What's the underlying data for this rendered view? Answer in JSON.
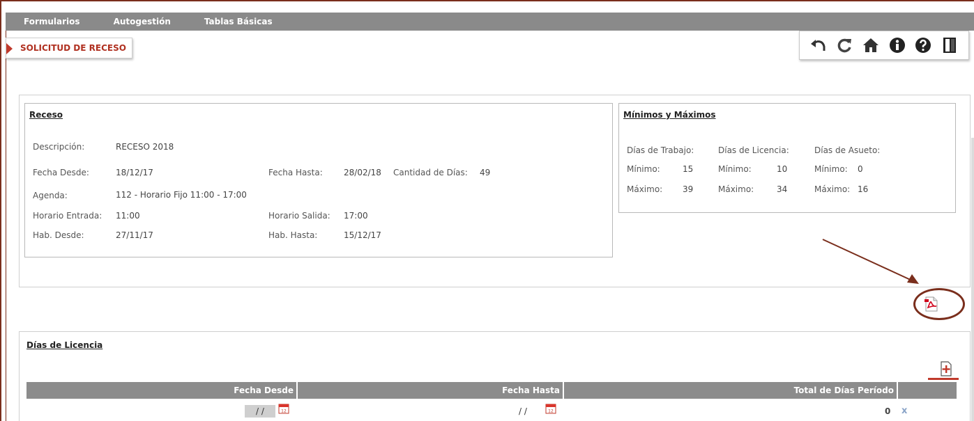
{
  "menu": [
    "Formularios",
    "Autogestión",
    "Tablas Básicas"
  ],
  "page_title": "SOLICITUD DE RECESO",
  "toolbar": [
    "back-icon",
    "refresh-icon",
    "home-icon",
    "info-icon",
    "help-icon",
    "exit-icon"
  ],
  "receso": {
    "title": "Receso",
    "descripcion_label": "Descripción:",
    "descripcion": "RECESO 2018",
    "fecha_desde_label": "Fecha Desde:",
    "fecha_desde": "18/12/17",
    "fecha_hasta_label": "Fecha Hasta:",
    "fecha_hasta": "28/02/18",
    "cantidad_label": "Cantidad de Días:",
    "cantidad": "49",
    "agenda_label": "Agenda:",
    "agenda": "112 - Horario Fijo 11:00 - 17:00",
    "horario_entrada_label": "Horario Entrada:",
    "horario_entrada": "11:00",
    "horario_salida_label": "Horario Salida:",
    "horario_salida": "17:00",
    "hab_desde_label": "Hab. Desde:",
    "hab_desde": "27/11/17",
    "hab_hasta_label": "Hab. Hasta:",
    "hab_hasta": "15/12/17"
  },
  "minmax": {
    "title": "Mínimos y Máximos",
    "trabajo": {
      "label": "Días de Trabajo:",
      "min_label": "Mínimo:",
      "min": "15",
      "max_label": "Máximo:",
      "max": "39"
    },
    "licencia": {
      "label": "Días de Licencia:",
      "min_label": "Mínimo:",
      "min": "10",
      "max_label": "Máximo:",
      "max": "34"
    },
    "asueto": {
      "label": "Días de Asueto:",
      "min_label": "Mínimo:",
      "min": "0",
      "max_label": "Máximo:",
      "max": "16"
    }
  },
  "licencia": {
    "title": "Días de Licencia",
    "columns": [
      "Fecha Desde",
      "Fecha Hasta",
      "Total de Días Período"
    ],
    "row": {
      "fecha_desde": "/ /",
      "fecha_hasta": "/ /",
      "total": "0",
      "delete": "x"
    }
  },
  "colors": {
    "menu_bg": "#8a8a8a",
    "accent": "#c0392b",
    "annotation": "#7a2e1c"
  }
}
